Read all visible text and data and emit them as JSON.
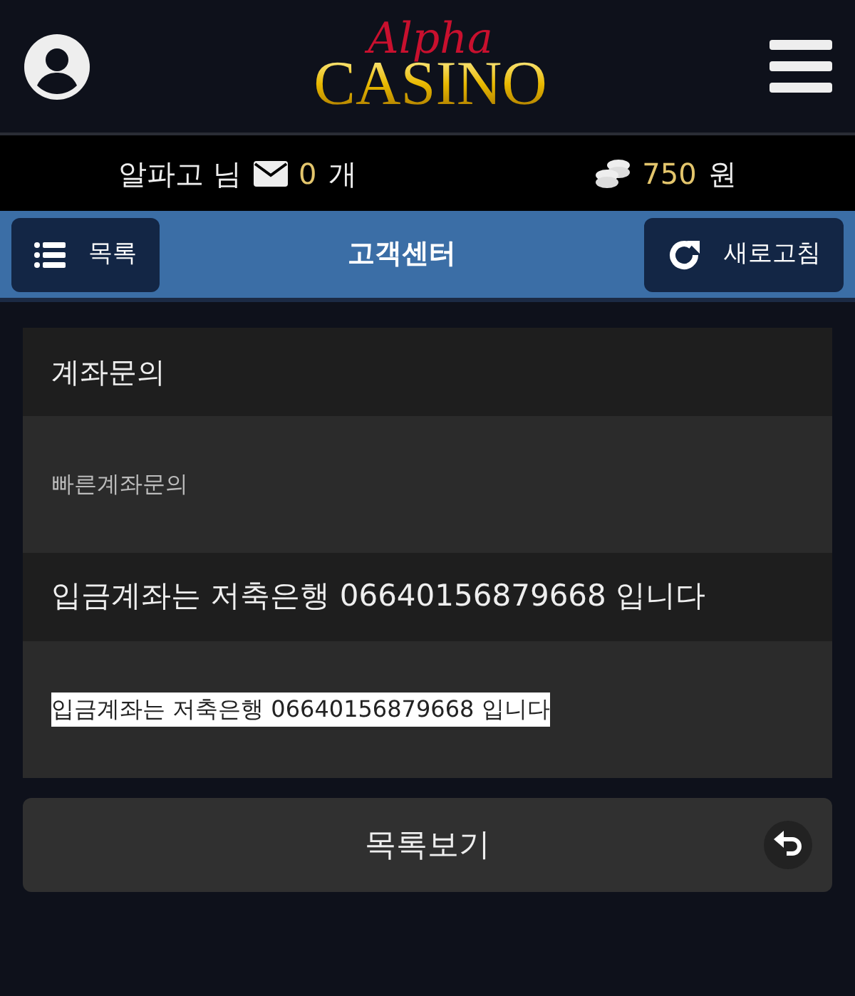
{
  "header": {
    "logo_script": "Alpha",
    "logo_main": "CASINO"
  },
  "user_bar": {
    "username": "알파고 님",
    "message_count": "0",
    "message_unit": "개",
    "balance": "750",
    "balance_unit": "원"
  },
  "toolbar": {
    "list_button": "목록",
    "title": "고객센터",
    "refresh_button": "새로고침"
  },
  "post": {
    "title": "계좌문의",
    "subtitle": "빠른계좌문의",
    "reply_heading": "입금계좌는 저축은행 06640156879668 입니다",
    "body": "입금계좌는 저축은행 06640156879668 입니다"
  },
  "back_button": "목록보기"
}
